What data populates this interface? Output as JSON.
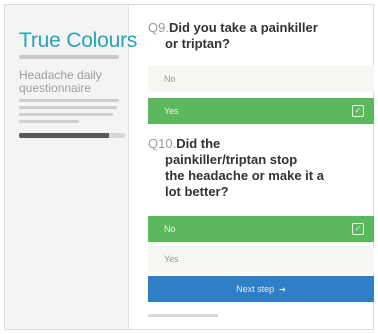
{
  "sidebar": {
    "logo": "True Colours",
    "title": "Headache daily questionnaire",
    "progress": 0.85
  },
  "q9": {
    "number": "Q9.",
    "text_line1": "Did you take a painkiller",
    "text_line2": "or triptan?",
    "options": [
      {
        "label": "No",
        "selected": false
      },
      {
        "label": "Yes",
        "selected": true
      }
    ]
  },
  "q10": {
    "number": "Q10.",
    "text_line1": "Did the",
    "text_line2": "painkiller/triptan stop",
    "text_line3": "the headache or make it a",
    "text_line4": "lot better?",
    "options": [
      {
        "label": "No",
        "selected": true
      },
      {
        "label": "Yes",
        "selected": false
      }
    ]
  },
  "next_button": {
    "label": "Next step",
    "icon": "arrow-right-icon"
  },
  "colors": {
    "brand": "#2aa3b8",
    "selected": "#5cb85c",
    "primary": "#2e7fc6"
  }
}
